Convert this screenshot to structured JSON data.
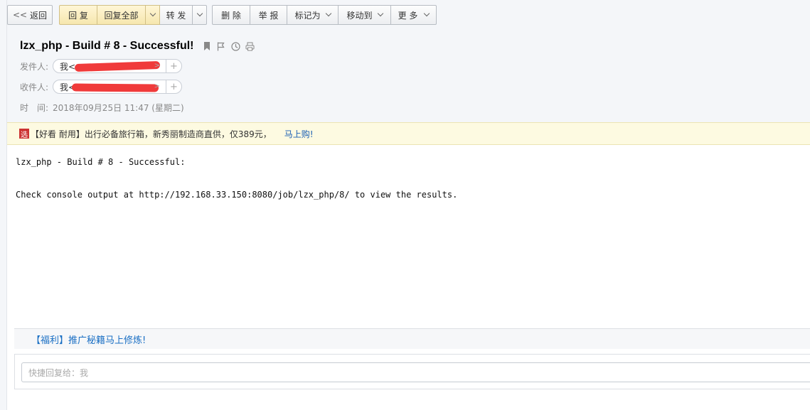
{
  "toolbar": {
    "back": "返回",
    "reply": "回 复",
    "reply_all": "回复全部",
    "forward": "转 发",
    "delete": "删 除",
    "report": "举 报",
    "mark_as": "标记为",
    "move_to": "移动到",
    "more": "更 多"
  },
  "header": {
    "subject": "lzx_php - Build # 8 - Successful!",
    "from_label": "发件人:",
    "from_name": "我<",
    "from_tail": ">",
    "to_label": "收件人:",
    "to_name": "我<",
    "to_tail": ">",
    "time_label": "时　间:",
    "time_value": "2018年09月25日 11:47 (星期二)",
    "icons": [
      "bookmark-icon",
      "flag-icon",
      "clock-icon",
      "print-icon"
    ]
  },
  "promo": {
    "badge": "选",
    "text": "【好看 耐用】出行必备旅行箱，新秀丽制造商直供，仅389元，",
    "link": "马上购!"
  },
  "body": {
    "line1": "lzx_php - Build # 8 - Successful:",
    "line2": "Check console output at http://192.168.33.150:8080/job/lzx_php/8/ to view the results."
  },
  "footer": {
    "ad": "【福利】推广秘籍马上修炼!",
    "quick_reply_placeholder": "快捷回复给：我"
  }
}
